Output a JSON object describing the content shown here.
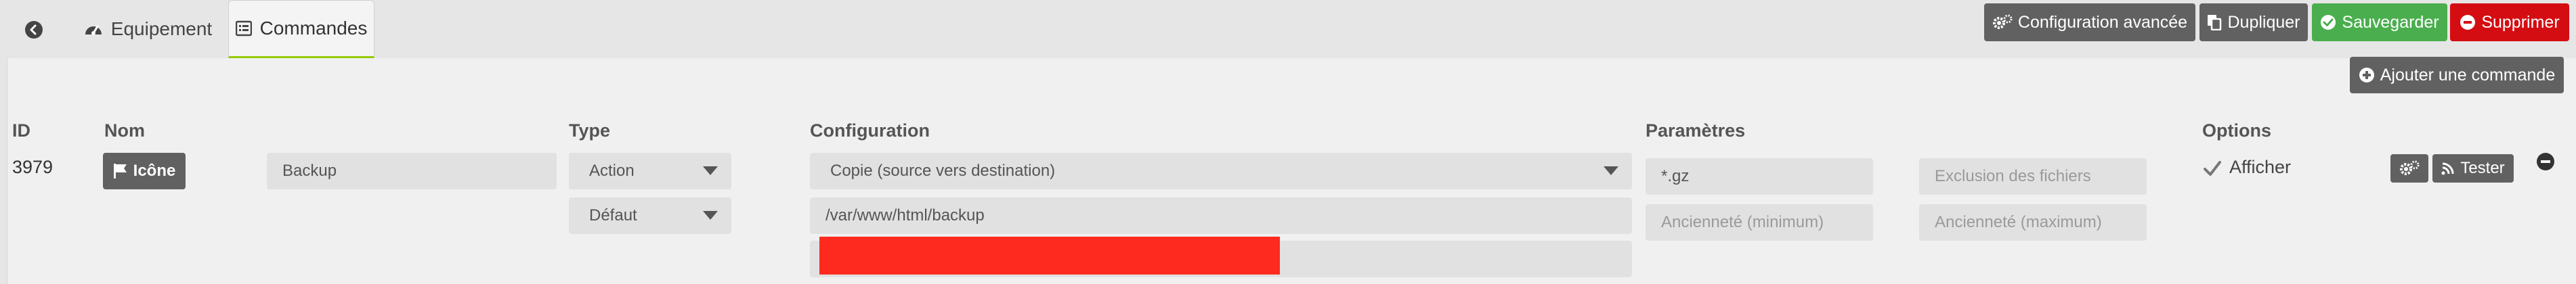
{
  "tabs": {
    "back_icon": "arrow-circle-left-icon",
    "equipement_label": "Equipement",
    "commandes_label": "Commandes"
  },
  "toolbar": {
    "config_label": "Configuration avancée",
    "dupliquer_label": "Dupliquer",
    "sauvegarder_label": "Sauvegarder",
    "supprimer_label": "Supprimer",
    "add_command_label": "Ajouter une commande"
  },
  "columns": {
    "id": "ID",
    "nom": "Nom",
    "type": "Type",
    "configuration": "Configuration",
    "parametres": "Paramètres",
    "options": "Options"
  },
  "command": {
    "id": "3979",
    "icon_button_label": "Icône",
    "name": "Backup",
    "type": "Action",
    "subtype": "Défaut",
    "config_select": "Copie (source vers destination)",
    "destination": "/var/www/html/backup",
    "param_pattern": "*.gz",
    "param_exclusion_placeholder": "Exclusion des fichiers",
    "param_age_min_placeholder": "Ancienneté (minimum)",
    "param_age_max_placeholder": "Ancienneté (maximum)",
    "afficher_label": "Afficher",
    "afficher_checked": true,
    "tester_label": "Tester"
  },
  "colors": {
    "accent_green": "#94ca02",
    "button_dark": "#616161",
    "button_green": "#4aae4e",
    "button_red": "#d40d12",
    "redaction": "#fe2a1f"
  }
}
